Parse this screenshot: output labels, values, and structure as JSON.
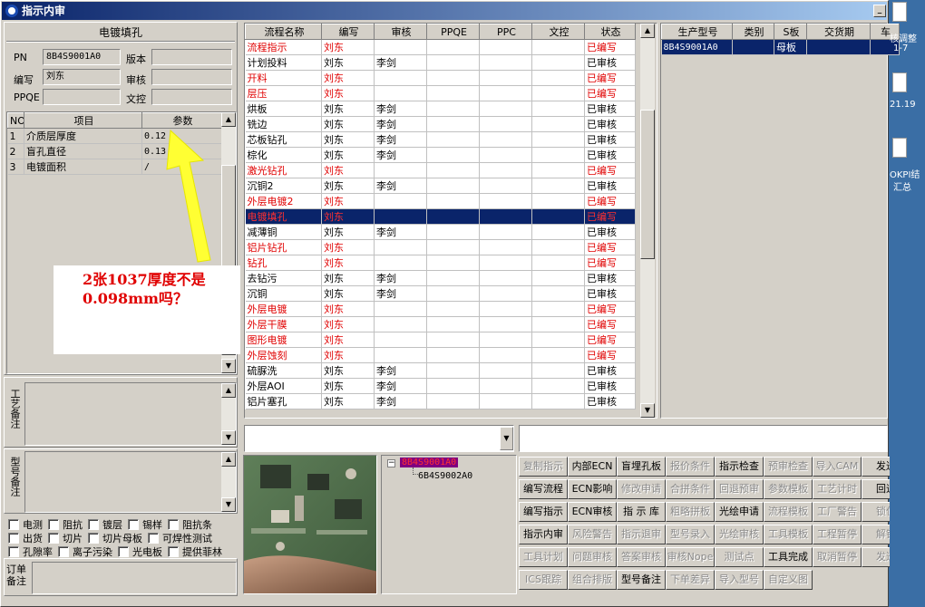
{
  "window": {
    "title": "指示内审",
    "min_label": "_"
  },
  "left": {
    "header": "电镀填孔",
    "pn_label": "PN",
    "pn_value": "8B4S9001A0",
    "version_label": "版本",
    "version_value": "",
    "author_label": "编写",
    "author_value": "刘东",
    "review_label": "审核",
    "review_value": "",
    "ppqe_label": "PPQE",
    "ppqe_value": "",
    "doc_label": "文控",
    "doc_value": "",
    "param_cols": [
      "NO",
      "项目",
      "参数"
    ],
    "params": [
      {
        "no": "1",
        "item": "介质层厚度",
        "value": "0.12"
      },
      {
        "no": "2",
        "item": "盲孔直径",
        "value": "0.13"
      },
      {
        "no": "3",
        "item": "电镀面积",
        "value": "/"
      }
    ],
    "annotation_text": "2张1037厚度不是0.098mm吗？",
    "process_note_label": "工艺备注",
    "model_note_label": "型号备注",
    "order_note_label": "订单备注",
    "checks_row1": [
      "电测",
      "阻抗",
      "镀层",
      "锡样",
      "阻抗条"
    ],
    "checks_row2": [
      "出货",
      "切片",
      "切片母板",
      "可焊性测试"
    ],
    "checks_row3": [
      "孔隙率",
      "离子污染",
      "光电板",
      "提供菲林"
    ]
  },
  "flow": {
    "columns": [
      "流程名称",
      "编写",
      "审核",
      "PPQE",
      "PPC",
      "文控",
      "状态"
    ],
    "rows": [
      {
        "name": "流程指示",
        "author": "刘东",
        "review": "",
        "status": "已编写",
        "style": "red"
      },
      {
        "name": "计划投料",
        "author": "刘东",
        "review": "李剑",
        "status": "已审核",
        "style": ""
      },
      {
        "name": "开料",
        "author": "刘东",
        "review": "",
        "status": "已编写",
        "style": "red"
      },
      {
        "name": "层压",
        "author": "刘东",
        "review": "",
        "status": "已编写",
        "style": "red"
      },
      {
        "name": "烘板",
        "author": "刘东",
        "review": "李剑",
        "status": "已审核",
        "style": ""
      },
      {
        "name": "铣边",
        "author": "刘东",
        "review": "李剑",
        "status": "已审核",
        "style": ""
      },
      {
        "name": "芯板钻孔",
        "author": "刘东",
        "review": "李剑",
        "status": "已审核",
        "style": ""
      },
      {
        "name": "棕化",
        "author": "刘东",
        "review": "李剑",
        "status": "已审核",
        "style": ""
      },
      {
        "name": "激光钻孔",
        "author": "刘东",
        "review": "",
        "status": "已编写",
        "style": "red"
      },
      {
        "name": "沉铜2",
        "author": "刘东",
        "review": "李剑",
        "status": "已审核",
        "style": ""
      },
      {
        "name": "外层电镀2",
        "author": "刘东",
        "review": "",
        "status": "已编写",
        "style": "red"
      },
      {
        "name": "电镀填孔",
        "author": "刘东",
        "review": "",
        "status": "已编写",
        "style": "sel"
      },
      {
        "name": "减薄铜",
        "author": "刘东",
        "review": "李剑",
        "status": "已审核",
        "style": ""
      },
      {
        "name": "铝片钻孔",
        "author": "刘东",
        "review": "",
        "status": "已编写",
        "style": "red"
      },
      {
        "name": "钻孔",
        "author": "刘东",
        "review": "",
        "status": "已编写",
        "style": "red"
      },
      {
        "name": "去钻污",
        "author": "刘东",
        "review": "李剑",
        "status": "已审核",
        "style": ""
      },
      {
        "name": "沉铜",
        "author": "刘东",
        "review": "李剑",
        "status": "已审核",
        "style": ""
      },
      {
        "name": "外层电镀",
        "author": "刘东",
        "review": "",
        "status": "已编写",
        "style": "red"
      },
      {
        "name": "外层干膜",
        "author": "刘东",
        "review": "",
        "status": "已编写",
        "style": "red"
      },
      {
        "name": "图形电镀",
        "author": "刘东",
        "review": "",
        "status": "已编写",
        "style": "red"
      },
      {
        "name": "外层蚀刻",
        "author": "刘东",
        "review": "",
        "status": "已编写",
        "style": "red"
      },
      {
        "name": "硫脲洗",
        "author": "刘东",
        "review": "李剑",
        "status": "已审核",
        "style": ""
      },
      {
        "name": "外层AOI",
        "author": "刘东",
        "review": "李剑",
        "status": "已审核",
        "style": ""
      },
      {
        "name": "铝片塞孔",
        "author": "刘东",
        "review": "李剑",
        "status": "已审核",
        "style": ""
      }
    ]
  },
  "prod": {
    "columns": [
      "生产型号",
      "类别",
      "S板",
      "交货期",
      "车"
    ],
    "rows": [
      {
        "model": "8B4S9001A0",
        "type": "",
        "sboard": "母板",
        "due": "",
        "car": ""
      }
    ]
  },
  "tree": {
    "root": "8B4S9001A0",
    "child": "6B4S9002A0"
  },
  "buttons": [
    [
      {
        "t": "复制指示",
        "e": false
      },
      {
        "t": "内部ECN",
        "e": true
      },
      {
        "t": "盲埋孔板",
        "e": true
      },
      {
        "t": "报价条件",
        "e": false
      },
      {
        "t": "指示检查",
        "e": true
      },
      {
        "t": "预审检查",
        "e": false
      },
      {
        "t": "导入CAM",
        "e": false
      },
      {
        "t": "发送",
        "e": true
      }
    ],
    [
      {
        "t": "编写流程",
        "e": true
      },
      {
        "t": "ECN影响",
        "e": true
      },
      {
        "t": "修改申请",
        "e": false
      },
      {
        "t": "合拼条件",
        "e": false
      },
      {
        "t": "回退预审",
        "e": false
      },
      {
        "t": "参数模板",
        "e": false
      },
      {
        "t": "工艺计时",
        "e": false
      },
      {
        "t": "回退",
        "e": true
      }
    ],
    [
      {
        "t": "编写指示",
        "e": true
      },
      {
        "t": "ECN审核",
        "e": true
      },
      {
        "t": "指 示 库",
        "e": true
      },
      {
        "t": "粗略拼板",
        "e": false
      },
      {
        "t": "光绘申请",
        "e": true
      },
      {
        "t": "流程模板",
        "e": false
      },
      {
        "t": "工厂警告",
        "e": false
      },
      {
        "t": "锁住",
        "e": false
      }
    ],
    [
      {
        "t": "指示内审",
        "e": true
      },
      {
        "t": "风险警告",
        "e": false
      },
      {
        "t": "指示退审",
        "e": false
      },
      {
        "t": "型号录入",
        "e": false
      },
      {
        "t": "光绘审核",
        "e": false
      },
      {
        "t": "工具模板",
        "e": false
      },
      {
        "t": "工程暂停",
        "e": false
      },
      {
        "t": "解锁",
        "e": false
      }
    ],
    [
      {
        "t": "工具计划",
        "e": false
      },
      {
        "t": "问题审核",
        "e": false
      },
      {
        "t": "答案审核",
        "e": false
      },
      {
        "t": "审核Nope",
        "e": false
      },
      {
        "t": "测试点",
        "e": false
      },
      {
        "t": "工具完成",
        "e": true
      },
      {
        "t": "取消暂停",
        "e": false
      },
      {
        "t": "发送",
        "e": false
      }
    ],
    [
      {
        "t": "ICS跟踪",
        "e": false
      },
      {
        "t": "组合排版",
        "e": false
      },
      {
        "t": "型号备注",
        "e": true
      },
      {
        "t": "下单差异",
        "e": false
      },
      {
        "t": "导入型号",
        "e": false
      },
      {
        "t": "自定义图",
        "e": false
      }
    ]
  ],
  "desktop": [
    "核调整",
    "1-7",
    "21.19",
    "OKPI结",
    "汇总"
  ]
}
